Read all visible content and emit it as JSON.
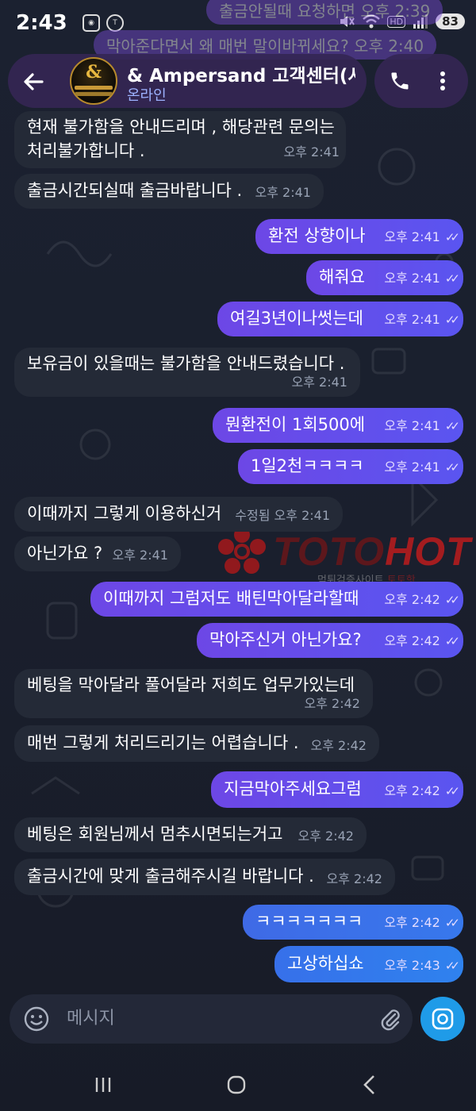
{
  "status_bar": {
    "time": "2:43",
    "left_icons": [
      "screen-record-icon",
      "kakaotalk-icon"
    ],
    "right_icons": [
      "mute-icon",
      "wifi-icon",
      "hd-voice-icon",
      "signal-icon"
    ],
    "battery": "83",
    "hd_label": "HD"
  },
  "ghost_messages": [
    {
      "text": "출금안될때 요청하면  오후 2:39"
    },
    {
      "text": "막아준다면서 왜 매번 말이바뀌세요?  오후 2:40"
    }
  ],
  "header": {
    "title": "& Ampersand 고객센터(사",
    "status": "온라인",
    "avatar_text": "&"
  },
  "messages": [
    {
      "dir": "in",
      "text": "현재 불가함을 안내드리며 , 해당관련 문의는",
      "text2": "처리불가합니다 .",
      "time": "오후 2:41"
    },
    {
      "dir": "in",
      "text": "출금시간되실때 출금바랍니다 .",
      "time": "오후 2:41"
    },
    {
      "dir": "out",
      "text": "환전 상향이나",
      "time": "오후 2:41"
    },
    {
      "dir": "out",
      "text": "해줘요",
      "time": "오후 2:41"
    },
    {
      "dir": "out",
      "text": "여길3년이나썻는데",
      "time": "오후 2:41"
    },
    {
      "dir": "in",
      "text": "보유금이 있을때는 불가함을 안내드렸습니다 .",
      "time": "오후 2:41"
    },
    {
      "dir": "out",
      "text": "뭔환전이 1회500에",
      "time": "오후 2:41"
    },
    {
      "dir": "out",
      "text": "1일2천ㅋㅋㅋㅋ",
      "time": "오후 2:41"
    },
    {
      "dir": "in",
      "text": "이때까지 그렇게 이용하신거",
      "time": "수정됨 오후 2:41"
    },
    {
      "dir": "in",
      "text": "아닌가요 ?",
      "time": "오후 2:41"
    },
    {
      "dir": "out",
      "text": "이때까지 그럼저도 배틴막아달라할때",
      "time": "오후 2:42"
    },
    {
      "dir": "out",
      "text": "막아주신거 아닌가요?",
      "time": "오후 2:42"
    },
    {
      "dir": "in",
      "text": "베팅을 막아달라 풀어달라 저희도 업무가있는데",
      "time": "오후 2:42"
    },
    {
      "dir": "in",
      "text": "매번 그렇게 처리드리기는 어렵습니다 .",
      "time": "오후 2:42"
    },
    {
      "dir": "out",
      "text": "지금막아주세요그럼",
      "time": "오후 2:42"
    },
    {
      "dir": "in",
      "text": "베팅은 회원님께서 멈추시면되는거고",
      "time": "오후 2:42"
    },
    {
      "dir": "in",
      "text": "출금시간에 맞게 출금해주시길 바랍니다 .",
      "time": "오후 2:42"
    },
    {
      "dir": "out",
      "text": "ㅋㅋㅋㅋㅋㅋㅋ",
      "time": "오후 2:42"
    },
    {
      "dir": "out",
      "text": "고상하십쇼",
      "time": "오후 2:43"
    }
  ],
  "watermark": {
    "brand_part1": "TOTO",
    "brand_part2": "HOT",
    "sub_left": "먹튀검증사이트",
    "sub_right": "토토핫"
  },
  "composer": {
    "placeholder": "메시지"
  },
  "colors": {
    "incoming_bubble": "#242a37",
    "outgoing_bubble": "#6d47e6",
    "accent_blue": "#1f9be8",
    "header": "#342654"
  }
}
